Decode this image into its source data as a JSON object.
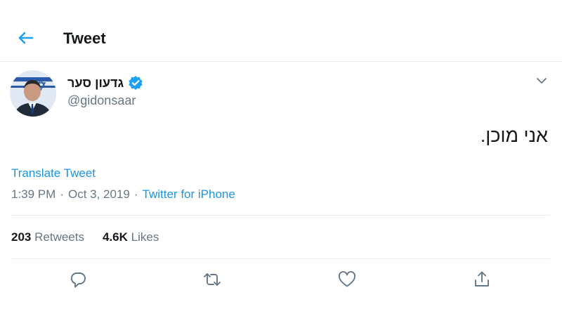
{
  "header": {
    "title": "Tweet"
  },
  "author": {
    "display_name": "גדעון סער",
    "handle": "@gidonsaar",
    "verified": true
  },
  "tweet": {
    "text": "אני מוכן."
  },
  "translate_label": "Translate Tweet",
  "meta": {
    "time": "1:39 PM",
    "separator": "·",
    "date": "Oct 3, 2019",
    "source": "Twitter for iPhone"
  },
  "stats": {
    "retweets": {
      "count": "203",
      "label": "Retweets"
    },
    "likes": {
      "count": "4.6K",
      "label": "Likes"
    }
  },
  "actions": [
    "reply-icon",
    "retweet-icon",
    "like-icon",
    "share-icon"
  ],
  "colors": {
    "accent": "#1b95e0",
    "text": "#14171a",
    "muted": "#657786",
    "divider": "#e6ecf0",
    "verified": "#1da1f2"
  }
}
